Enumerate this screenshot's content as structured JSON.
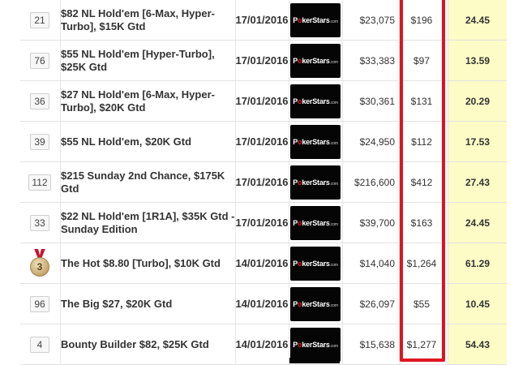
{
  "highlight_color": "#e0141e",
  "score_bg": "#fdfcc6",
  "rows": [
    {
      "pos": "21",
      "name": "$82 NL Hold'em [6-Max, Hyper-Turbo], $15K Gtd",
      "date": "17/01/2016",
      "site": "PokerStars",
      "pool": "$23,075",
      "winnings": "$196",
      "score": "24.45",
      "medal": false
    },
    {
      "pos": "76",
      "name": "$55 NL Hold'em [Hyper-Turbo], $25K Gtd",
      "date": "17/01/2016",
      "site": "PokerStars",
      "pool": "$33,383",
      "winnings": "$97",
      "score": "13.59",
      "medal": false
    },
    {
      "pos": "36",
      "name": "$27 NL Hold'em [6-Max, Hyper-Turbo], $20K Gtd",
      "date": "17/01/2016",
      "site": "PokerStars",
      "pool": "$30,361",
      "winnings": "$131",
      "score": "20.29",
      "medal": false
    },
    {
      "pos": "39",
      "name": "$55 NL Hold'em, $20K Gtd",
      "date": "17/01/2016",
      "site": "PokerStars",
      "pool": "$24,950",
      "winnings": "$112",
      "score": "17.53",
      "medal": false
    },
    {
      "pos": "112",
      "name": "$215 Sunday 2nd Chance, $175K Gtd",
      "date": "17/01/2016",
      "site": "PokerStars",
      "pool": "$216,600",
      "winnings": "$412",
      "score": "27.43",
      "medal": false
    },
    {
      "pos": "33",
      "name": "$22 NL Hold'em [1R1A], $35K Gtd - Sunday Edition",
      "date": "17/01/2016",
      "site": "PokerStars",
      "pool": "$39,700",
      "winnings": "$163",
      "score": "24.45",
      "medal": false
    },
    {
      "pos": "3",
      "name": "The Hot $8.80 [Turbo], $10K Gtd",
      "date": "14/01/2016",
      "site": "PokerStars",
      "pool": "$14,040",
      "winnings": "$1,264",
      "score": "61.29",
      "medal": true
    },
    {
      "pos": "96",
      "name": "The Big $27, $20K Gtd",
      "date": "14/01/2016",
      "site": "PokerStars",
      "pool": "$26,097",
      "winnings": "$55",
      "score": "10.45",
      "medal": false
    },
    {
      "pos": "4",
      "name": "Bounty Builder $82, $25K Gtd",
      "date": "14/01/2016",
      "site": "PokerStars",
      "pool": "$15,638",
      "winnings": "$1,277",
      "score": "54.43",
      "medal": false
    }
  ]
}
